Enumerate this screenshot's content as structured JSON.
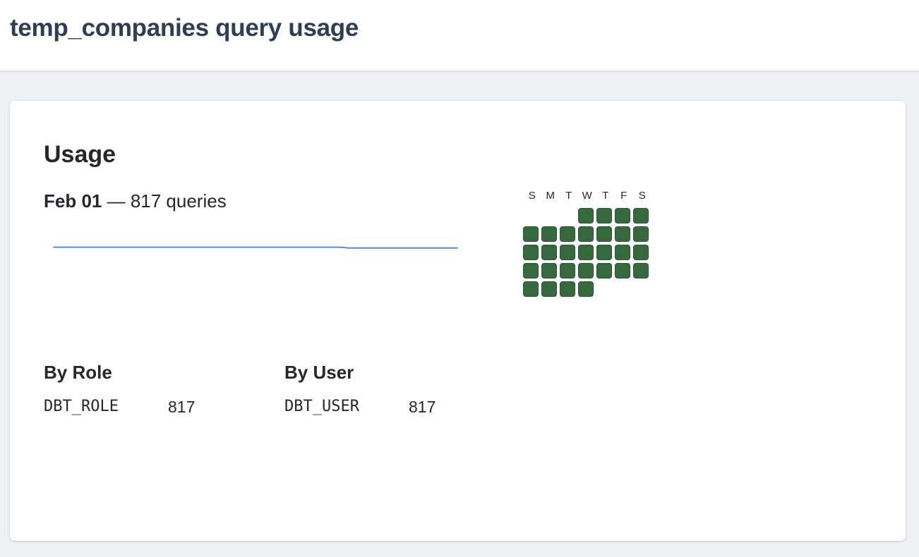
{
  "header": {
    "title": "temp_companies query usage"
  },
  "usage": {
    "title": "Usage",
    "summary": {
      "date": "Feb 01",
      "separator": " — ",
      "count_text": "817 queries"
    },
    "sparkline": {
      "color": "#5b86e5",
      "values": [
        817,
        817,
        817,
        817,
        817,
        817,
        817,
        817,
        817,
        817,
        817,
        817,
        817,
        817,
        817,
        817,
        817,
        817,
        817,
        817,
        816,
        816,
        816,
        816,
        816,
        816,
        816,
        816
      ]
    },
    "calendar": {
      "day_labels": [
        "S",
        "M",
        "T",
        "W",
        "T",
        "F",
        "S"
      ],
      "filled_color": "#366a3e",
      "weeks": [
        [
          0,
          0,
          0,
          1,
          1,
          1,
          1
        ],
        [
          1,
          1,
          1,
          1,
          1,
          1,
          1
        ],
        [
          1,
          1,
          1,
          1,
          1,
          1,
          1
        ],
        [
          1,
          1,
          1,
          1,
          1,
          1,
          1
        ],
        [
          1,
          1,
          1,
          1,
          0,
          0,
          0
        ]
      ]
    }
  },
  "by_role": {
    "title": "By Role",
    "rows": [
      {
        "name": "DBT_ROLE",
        "count": "817"
      }
    ]
  },
  "by_user": {
    "title": "By User",
    "rows": [
      {
        "name": "DBT_USER",
        "count": "817"
      }
    ]
  }
}
